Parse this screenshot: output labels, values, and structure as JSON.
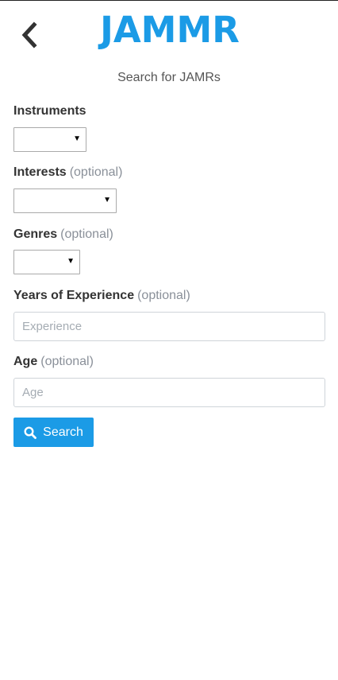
{
  "header": {
    "back_icon": "chevron-left-icon",
    "logo_text": "JAMMR",
    "subtitle": "Search for JAMRs"
  },
  "form": {
    "instruments": {
      "label": "Instruments",
      "selected": ""
    },
    "interests": {
      "label": "Interests",
      "optional": "(optional)",
      "selected": ""
    },
    "genres": {
      "label": "Genres",
      "optional": "(optional)",
      "selected": ""
    },
    "experience": {
      "label": "Years of Experience",
      "optional": "(optional)",
      "placeholder": "Experience",
      "value": ""
    },
    "age": {
      "label": "Age",
      "optional": "(optional)",
      "placeholder": "Age",
      "value": ""
    },
    "search_button": {
      "label": "Search",
      "icon": "search-icon"
    }
  },
  "colors": {
    "accent": "#1b9be6",
    "text": "#333333",
    "muted": "#8a9099"
  }
}
